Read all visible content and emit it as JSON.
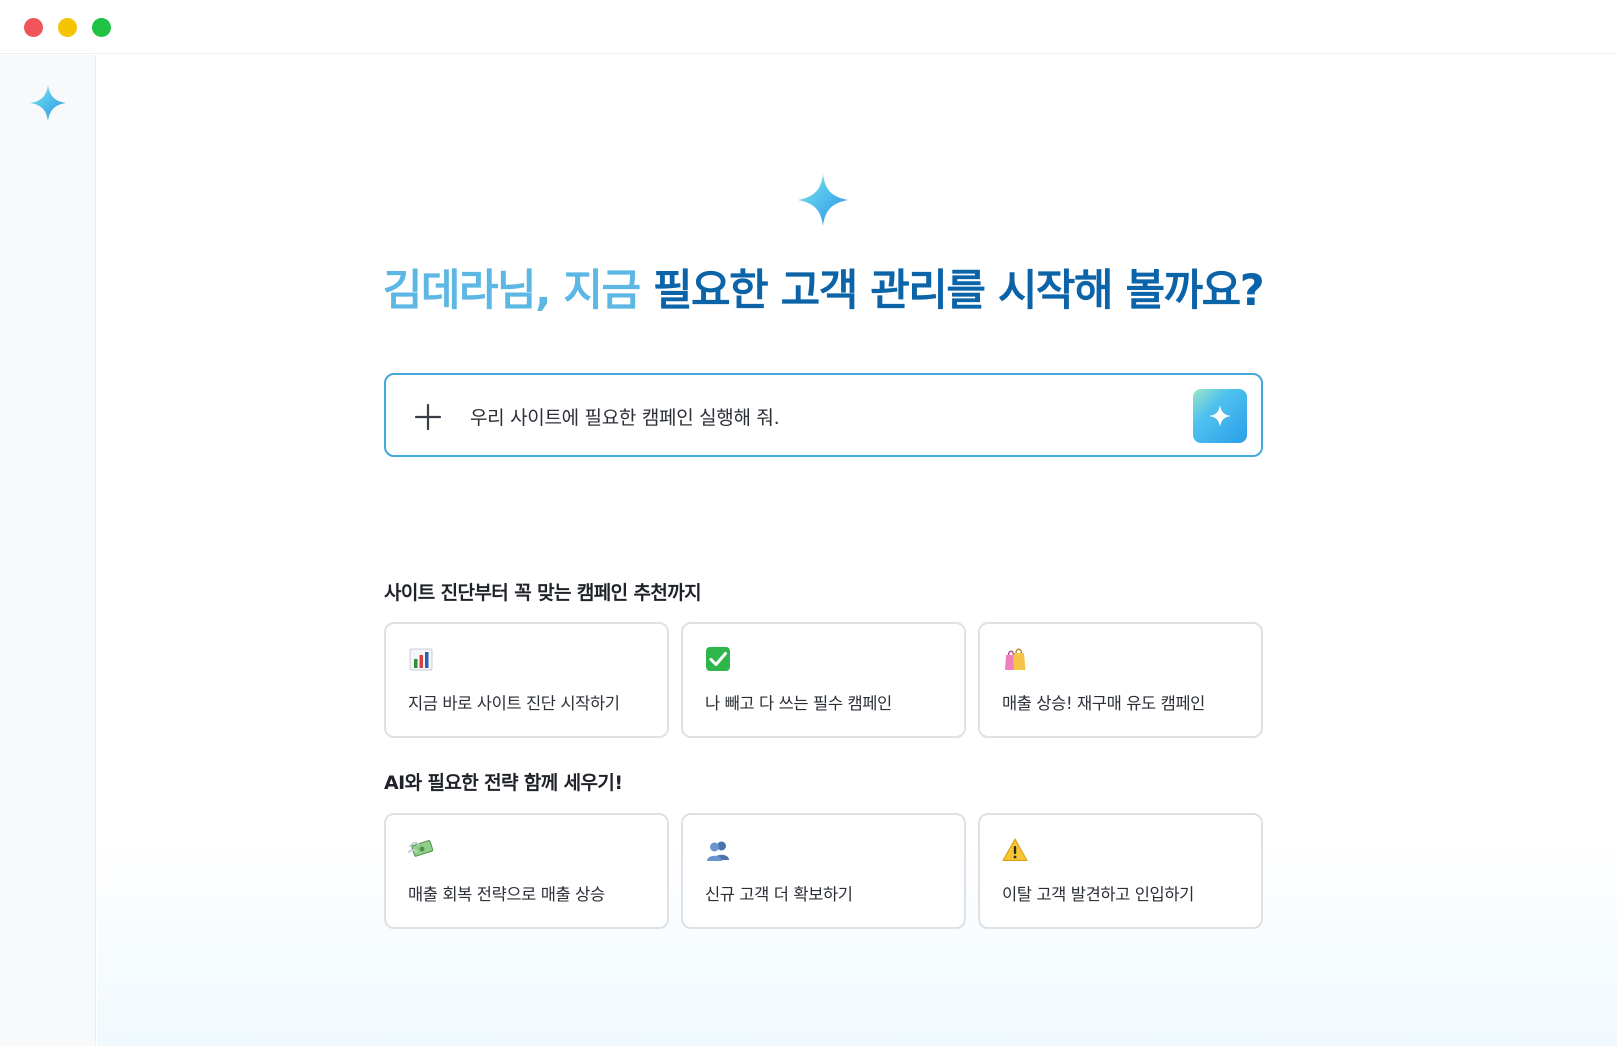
{
  "window": {
    "controls": [
      "close",
      "minimize",
      "maximize"
    ]
  },
  "sidebar": {
    "logo_icon": "sparkle-icon"
  },
  "hero": {
    "icon": "sparkle-icon",
    "headline_part1": "김데라님, 지금 ",
    "headline_part2": "필요한 고객 관리를 시작해 볼까요?",
    "colors": {
      "light": "#5db7e4",
      "dark": "#0b63a8"
    }
  },
  "prompt": {
    "add_icon": "plus-icon",
    "value": "우리 사이트에 필요한 캠페인 실행해 줘.",
    "send_icon": "sparkle-icon",
    "accent": "#45a8dc"
  },
  "sections": [
    {
      "title": "사이트 진단부터 꼭 맞는 캠페인 추천까지",
      "cards": [
        {
          "icon": "bar-chart-icon",
          "label": "지금 바로 사이트 진단 시작하기"
        },
        {
          "icon": "check-mark-icon",
          "label": "나 빼고 다 쓰는 필수 캠페인"
        },
        {
          "icon": "shopping-bags-icon",
          "label": "매출 상승! 재구매 유도 캠페인"
        }
      ]
    },
    {
      "title": "AI와 필요한 전략 함께 세우기!",
      "cards": [
        {
          "icon": "money-flying-icon",
          "label": "매출 회복 전략으로 매출 상승"
        },
        {
          "icon": "people-icon",
          "label": "신규 고객 더 확보하기"
        },
        {
          "icon": "warning-icon",
          "label": "이탈 고객 발견하고 인입하기"
        }
      ]
    }
  ]
}
